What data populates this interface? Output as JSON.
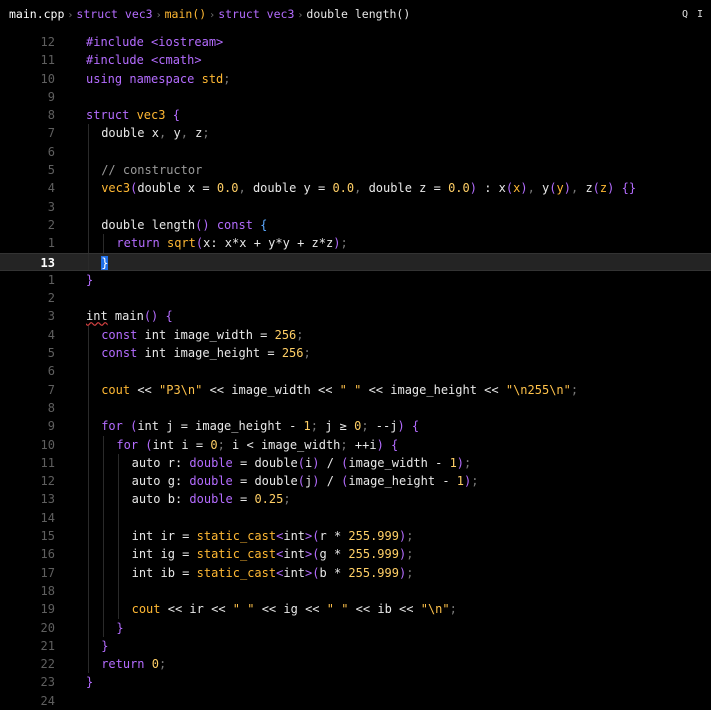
{
  "breadcrumb": {
    "items": [
      {
        "text": "main.cpp",
        "kind": "file"
      },
      {
        "prefix": "struct",
        "text": "vec3",
        "kind": "struct"
      },
      {
        "text": "main()",
        "kind": "function"
      },
      {
        "prefix": "struct",
        "text": "vec3",
        "kind": "struct"
      },
      {
        "prefix": "double",
        "text": "length()",
        "kind": "method"
      }
    ],
    "search_icon": "Q",
    "cursor_icon": "I"
  },
  "editor": {
    "current_line": 13,
    "lines": [
      {
        "n": "12",
        "indent": 0,
        "tokens": [
          [
            "pre",
            "#include "
          ],
          [
            "pre",
            "<iostream>"
          ]
        ]
      },
      {
        "n": "11",
        "indent": 0,
        "tokens": [
          [
            "pre",
            "#include "
          ],
          [
            "pre",
            "<cmath>"
          ]
        ]
      },
      {
        "n": "10",
        "indent": 0,
        "tokens": [
          [
            "kw",
            "using "
          ],
          [
            "kw",
            "namespace "
          ],
          [
            "fn",
            "std"
          ],
          [
            "pn",
            ";"
          ]
        ]
      },
      {
        "n": "9",
        "indent": 0,
        "tokens": []
      },
      {
        "n": "8",
        "indent": 0,
        "tokens": [
          [
            "kw",
            "struct "
          ],
          [
            "fn",
            "vec3"
          ],
          [
            "br",
            " {"
          ]
        ]
      },
      {
        "n": "7",
        "indent": 1,
        "tokens": [
          [
            "id",
            "double "
          ],
          [
            "id",
            "x"
          ],
          [
            "pn",
            ", "
          ],
          [
            "id",
            "y"
          ],
          [
            "pn",
            ", "
          ],
          [
            "id",
            "z"
          ],
          [
            "pn",
            ";"
          ]
        ]
      },
      {
        "n": "6",
        "indent": 1,
        "tokens": []
      },
      {
        "n": "5",
        "indent": 1,
        "tokens": [
          [
            "cm",
            "// constructor"
          ]
        ]
      },
      {
        "n": "4",
        "indent": 1,
        "tokens": [
          [
            "fn",
            "vec3"
          ],
          [
            "br",
            "("
          ],
          [
            "id",
            "double x "
          ],
          [
            "op",
            "= "
          ],
          [
            "num",
            "0.0"
          ],
          [
            "pn",
            ", "
          ],
          [
            "id",
            "double y "
          ],
          [
            "op",
            "= "
          ],
          [
            "num",
            "0.0"
          ],
          [
            "pn",
            ", "
          ],
          [
            "id",
            "double z "
          ],
          [
            "op",
            "= "
          ],
          [
            "num",
            "0.0"
          ],
          [
            "br",
            ") "
          ],
          [
            "op",
            ": "
          ],
          [
            "id",
            "x"
          ],
          [
            "br",
            "("
          ],
          [
            "fn",
            "x"
          ],
          [
            "br",
            ")"
          ],
          [
            "pn",
            ", "
          ],
          [
            "id",
            "y"
          ],
          [
            "br",
            "("
          ],
          [
            "fn",
            "y"
          ],
          [
            "br",
            ")"
          ],
          [
            "pn",
            ", "
          ],
          [
            "id",
            "z"
          ],
          [
            "br",
            "("
          ],
          [
            "fn",
            "z"
          ],
          [
            "br",
            ") "
          ],
          [
            "br",
            "{}"
          ]
        ]
      },
      {
        "n": "3",
        "indent": 1,
        "tokens": []
      },
      {
        "n": "2",
        "indent": 1,
        "tokens": [
          [
            "id",
            "double "
          ],
          [
            "id",
            "length"
          ],
          [
            "br",
            "() "
          ],
          [
            "kw",
            "const "
          ],
          [
            "bg",
            "{"
          ]
        ]
      },
      {
        "n": "1",
        "indent": 2,
        "tokens": [
          [
            "kw",
            "return "
          ],
          [
            "fn",
            "sqrt"
          ],
          [
            "br",
            "("
          ],
          [
            "id",
            "x"
          ],
          [
            "op",
            ": "
          ],
          [
            "id",
            "x"
          ],
          [
            "op",
            "*"
          ],
          [
            "id",
            "x "
          ],
          [
            "op",
            "+ "
          ],
          [
            "id",
            "y"
          ],
          [
            "op",
            "*"
          ],
          [
            "id",
            "y "
          ],
          [
            "op",
            "+ "
          ],
          [
            "id",
            "z"
          ],
          [
            "op",
            "*"
          ],
          [
            "id",
            "z"
          ],
          [
            "br",
            ")"
          ],
          [
            "pn",
            ";"
          ]
        ]
      },
      {
        "n": "13",
        "indent": 1,
        "tokens": [
          [
            "cur",
            "}"
          ]
        ]
      },
      {
        "n": "1",
        "indent": 0,
        "tokens": [
          [
            "br",
            "}"
          ]
        ]
      },
      {
        "n": "2",
        "indent": 0,
        "tokens": []
      },
      {
        "n": "3",
        "indent": 0,
        "tokens": [
          [
            "sq",
            "int"
          ],
          [
            "id",
            " main"
          ],
          [
            "br",
            "() {"
          ]
        ]
      },
      {
        "n": "4",
        "indent": 1,
        "tokens": [
          [
            "kw",
            "const "
          ],
          [
            "id",
            "int "
          ],
          [
            "id",
            "image_width "
          ],
          [
            "op",
            "= "
          ],
          [
            "num",
            "256"
          ],
          [
            "pn",
            ";"
          ]
        ]
      },
      {
        "n": "5",
        "indent": 1,
        "tokens": [
          [
            "kw",
            "const "
          ],
          [
            "id",
            "int "
          ],
          [
            "id",
            "image_height "
          ],
          [
            "op",
            "= "
          ],
          [
            "num",
            "256"
          ],
          [
            "pn",
            ";"
          ]
        ]
      },
      {
        "n": "6",
        "indent": 1,
        "tokens": []
      },
      {
        "n": "7",
        "indent": 1,
        "tokens": [
          [
            "fn",
            "cout "
          ],
          [
            "op",
            "<< "
          ],
          [
            "str",
            "\"P3\\n\" "
          ],
          [
            "op",
            "<< "
          ],
          [
            "id",
            "image_width "
          ],
          [
            "op",
            "<< "
          ],
          [
            "str",
            "\" \" "
          ],
          [
            "op",
            "<< "
          ],
          [
            "id",
            "image_height "
          ],
          [
            "op",
            "<< "
          ],
          [
            "str",
            "\"\\n255\\n\""
          ],
          [
            "pn",
            ";"
          ]
        ]
      },
      {
        "n": "8",
        "indent": 1,
        "tokens": []
      },
      {
        "n": "9",
        "indent": 1,
        "tokens": [
          [
            "kw",
            "for "
          ],
          [
            "br",
            "("
          ],
          [
            "id",
            "int j "
          ],
          [
            "op",
            "= "
          ],
          [
            "id",
            "image_height "
          ],
          [
            "op",
            "- "
          ],
          [
            "num",
            "1"
          ],
          [
            "pn",
            "; "
          ],
          [
            "id",
            "j "
          ],
          [
            "op",
            "≥ "
          ],
          [
            "num",
            "0"
          ],
          [
            "pn",
            "; "
          ],
          [
            "op",
            "--"
          ],
          [
            "id",
            "j"
          ],
          [
            "br",
            ") {"
          ]
        ]
      },
      {
        "n": "10",
        "indent": 2,
        "tokens": [
          [
            "kw",
            "for "
          ],
          [
            "br",
            "("
          ],
          [
            "id",
            "int i "
          ],
          [
            "op",
            "= "
          ],
          [
            "num",
            "0"
          ],
          [
            "pn",
            "; "
          ],
          [
            "id",
            "i "
          ],
          [
            "op",
            "< "
          ],
          [
            "id",
            "image_width"
          ],
          [
            "pn",
            "; "
          ],
          [
            "op",
            "++"
          ],
          [
            "id",
            "i"
          ],
          [
            "br",
            ") {"
          ]
        ]
      },
      {
        "n": "11",
        "indent": 3,
        "tokens": [
          [
            "id",
            "auto r"
          ],
          [
            "op",
            ": "
          ],
          [
            "kw",
            "double "
          ],
          [
            "op",
            "= "
          ],
          [
            "id",
            "double"
          ],
          [
            "br",
            "("
          ],
          [
            "id",
            "i"
          ],
          [
            "br",
            ") "
          ],
          [
            "op",
            "/ "
          ],
          [
            "br",
            "("
          ],
          [
            "id",
            "image_width "
          ],
          [
            "op",
            "- "
          ],
          [
            "num",
            "1"
          ],
          [
            "br",
            ")"
          ],
          [
            "pn",
            ";"
          ]
        ]
      },
      {
        "n": "12",
        "indent": 3,
        "tokens": [
          [
            "id",
            "auto g"
          ],
          [
            "op",
            ": "
          ],
          [
            "kw",
            "double "
          ],
          [
            "op",
            "= "
          ],
          [
            "id",
            "double"
          ],
          [
            "br",
            "("
          ],
          [
            "id",
            "j"
          ],
          [
            "br",
            ") "
          ],
          [
            "op",
            "/ "
          ],
          [
            "br",
            "("
          ],
          [
            "id",
            "image_height "
          ],
          [
            "op",
            "- "
          ],
          [
            "num",
            "1"
          ],
          [
            "br",
            ")"
          ],
          [
            "pn",
            ";"
          ]
        ]
      },
      {
        "n": "13",
        "indent": 3,
        "tokens": [
          [
            "id",
            "auto b"
          ],
          [
            "op",
            ": "
          ],
          [
            "kw",
            "double "
          ],
          [
            "op",
            "= "
          ],
          [
            "num",
            "0.25"
          ],
          [
            "pn",
            ";"
          ]
        ]
      },
      {
        "n": "14",
        "indent": 3,
        "tokens": []
      },
      {
        "n": "15",
        "indent": 3,
        "tokens": [
          [
            "id",
            "int ir "
          ],
          [
            "op",
            "= "
          ],
          [
            "fn",
            "static_cast"
          ],
          [
            "br",
            "<"
          ],
          [
            "id",
            "int"
          ],
          [
            "br",
            ">("
          ],
          [
            "id",
            "r "
          ],
          [
            "op",
            "* "
          ],
          [
            "num",
            "255.999"
          ],
          [
            "br",
            ")"
          ],
          [
            "pn",
            ";"
          ]
        ]
      },
      {
        "n": "16",
        "indent": 3,
        "tokens": [
          [
            "id",
            "int ig "
          ],
          [
            "op",
            "= "
          ],
          [
            "fn",
            "static_cast"
          ],
          [
            "br",
            "<"
          ],
          [
            "id",
            "int"
          ],
          [
            "br",
            ">("
          ],
          [
            "id",
            "g "
          ],
          [
            "op",
            "* "
          ],
          [
            "num",
            "255.999"
          ],
          [
            "br",
            ")"
          ],
          [
            "pn",
            ";"
          ]
        ]
      },
      {
        "n": "17",
        "indent": 3,
        "tokens": [
          [
            "id",
            "int ib "
          ],
          [
            "op",
            "= "
          ],
          [
            "fn",
            "static_cast"
          ],
          [
            "br",
            "<"
          ],
          [
            "id",
            "int"
          ],
          [
            "br",
            ">("
          ],
          [
            "id",
            "b "
          ],
          [
            "op",
            "* "
          ],
          [
            "num",
            "255.999"
          ],
          [
            "br",
            ")"
          ],
          [
            "pn",
            ";"
          ]
        ]
      },
      {
        "n": "18",
        "indent": 3,
        "tokens": []
      },
      {
        "n": "19",
        "indent": 3,
        "tokens": [
          [
            "fn",
            "cout "
          ],
          [
            "op",
            "<< "
          ],
          [
            "id",
            "ir "
          ],
          [
            "op",
            "<< "
          ],
          [
            "str",
            "\" \" "
          ],
          [
            "op",
            "<< "
          ],
          [
            "id",
            "ig "
          ],
          [
            "op",
            "<< "
          ],
          [
            "str",
            "\" \" "
          ],
          [
            "op",
            "<< "
          ],
          [
            "id",
            "ib "
          ],
          [
            "op",
            "<< "
          ],
          [
            "str",
            "\"\\n\""
          ],
          [
            "pn",
            ";"
          ]
        ]
      },
      {
        "n": "20",
        "indent": 2,
        "tokens": [
          [
            "br",
            "}"
          ]
        ]
      },
      {
        "n": "21",
        "indent": 1,
        "tokens": [
          [
            "br",
            "}"
          ]
        ]
      },
      {
        "n": "22",
        "indent": 1,
        "tokens": [
          [
            "kw",
            "return "
          ],
          [
            "num",
            "0"
          ],
          [
            "pn",
            ";"
          ]
        ]
      },
      {
        "n": "23",
        "indent": 0,
        "tokens": [
          [
            "br",
            "}"
          ]
        ]
      },
      {
        "n": "24",
        "indent": 0,
        "tokens": []
      }
    ]
  },
  "colors": {
    "background": "#000000",
    "current_line": "#242424",
    "keyword": "#b46cff",
    "function": "#ffb833",
    "number": "#ffcf66",
    "cursor": "#1f6fe8"
  }
}
